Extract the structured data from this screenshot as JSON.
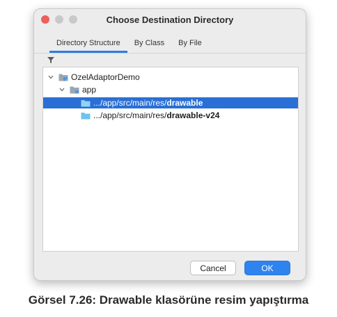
{
  "window": {
    "title": "Choose Destination Directory"
  },
  "tabs": [
    {
      "label": "Directory Structure",
      "active": true
    },
    {
      "label": "By Class",
      "active": false
    },
    {
      "label": "By File",
      "active": false
    }
  ],
  "tree": {
    "root": {
      "label": "OzelAdaptorDemo",
      "icon": "project-module-icon",
      "expanded": true
    },
    "module": {
      "label": "app",
      "icon": "module-folder-icon",
      "expanded": true
    },
    "items": [
      {
        "prefix": ".../app/src/main/res/",
        "name": "drawable",
        "icon": "folder-icon",
        "selected": true
      },
      {
        "prefix": ".../app/src/main/res/",
        "name": "drawable-v24",
        "icon": "folder-icon",
        "selected": false
      }
    ]
  },
  "buttons": {
    "cancel": "Cancel",
    "ok": "OK"
  },
  "caption": "Görsel 7.26: Drawable klasörüne resim yapıştırma",
  "colors": {
    "selection": "#2a6fd6",
    "primary_button": "#2f83ee",
    "traffic_close": "#ee5f58",
    "traffic_minimize": "#c9c9c9",
    "traffic_zoom": "#c9c9c9",
    "folder": "#6fc3f0"
  }
}
